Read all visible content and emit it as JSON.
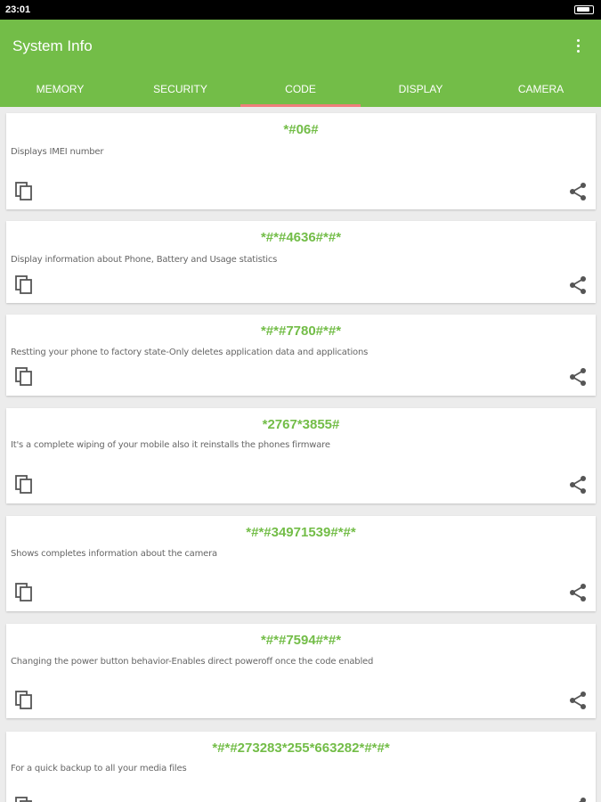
{
  "status_bar": {
    "time": "23:01"
  },
  "app_bar": {
    "title": "System Info",
    "menu_icon": "overflow-menu-icon"
  },
  "tabs": [
    {
      "label": "MEMORY",
      "active": false
    },
    {
      "label": "SECURITY",
      "active": false
    },
    {
      "label": "CODE",
      "active": true
    },
    {
      "label": "DISPLAY",
      "active": false
    },
    {
      "label": "CAMERA",
      "active": false
    }
  ],
  "colors": {
    "accent": "#73bd48",
    "tab_indicator": "#ef7e7b",
    "background": "#ececec"
  },
  "codes": [
    {
      "code": "*#06#",
      "description": "Displays IMEI number"
    },
    {
      "code": "*#*#4636#*#*",
      "description": "Display information about Phone, Battery and Usage statistics"
    },
    {
      "code": "*#*#7780#*#*",
      "description": "Restting your phone to factory state-Only deletes application data and applications"
    },
    {
      "code": "*2767*3855#",
      "description": "It's a complete wiping of your mobile also it reinstalls the phones firmware"
    },
    {
      "code": "*#*#34971539#*#*",
      "description": "Shows completes information about the camera"
    },
    {
      "code": "*#*#7594#*#*",
      "description": "Changing the power button behavior-Enables direct poweroff once the code enabled"
    },
    {
      "code": "*#*#273283*255*663282*#*#*",
      "description": "For a quick backup to all your media files"
    }
  ]
}
